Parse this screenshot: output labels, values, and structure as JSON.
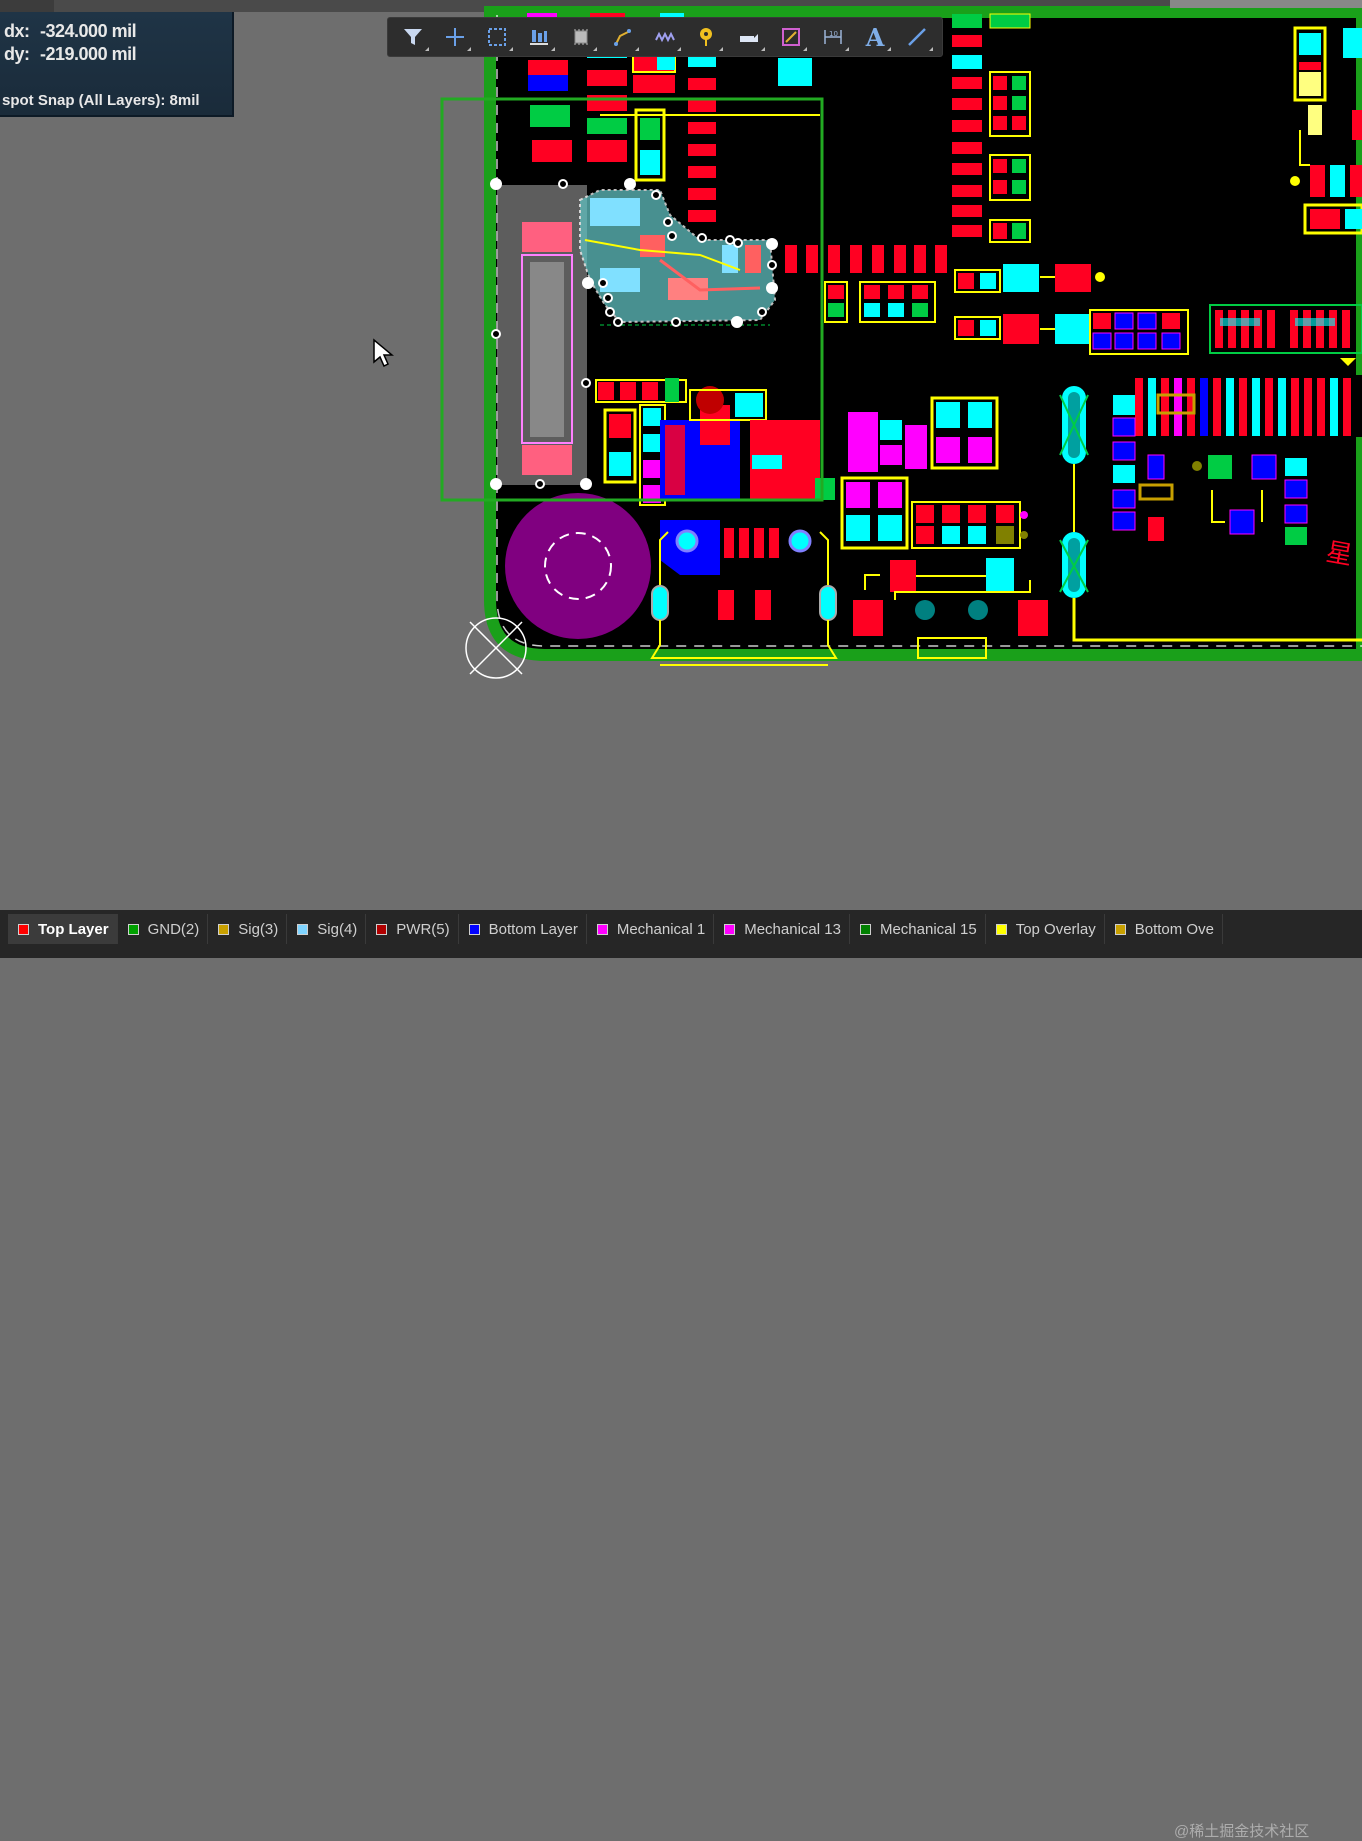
{
  "hud": {
    "dx_label": "dx:",
    "dx_value": "-324.000 mil",
    "dy_label": "dy:",
    "dy_value": "-219.000 mil",
    "snap_text": "spot Snap (All Layers): 8mil"
  },
  "toolbar": {
    "buttons": [
      {
        "icon": "filter-icon"
      },
      {
        "icon": "cross-add-icon"
      },
      {
        "icon": "select-rectangle-icon"
      },
      {
        "icon": "align-icon"
      },
      {
        "icon": "component-icon"
      },
      {
        "icon": "route-icon"
      },
      {
        "icon": "interactive-length-tune-icon"
      },
      {
        "icon": "place-via-icon"
      },
      {
        "icon": "polygon-pour-icon"
      },
      {
        "icon": "region-icon"
      },
      {
        "icon": "dimension-icon"
      },
      {
        "icon": "text-icon"
      },
      {
        "icon": "line-icon"
      }
    ],
    "text_icon_label": "A"
  },
  "layers": [
    {
      "name": "Top Layer",
      "color": "#ff0000",
      "active": true
    },
    {
      "name": "GND(2)",
      "color": "#00a000",
      "active": false
    },
    {
      "name": "Sig(3)",
      "color": "#c8a000",
      "active": false
    },
    {
      "name": "Sig(4)",
      "color": "#7fd4ff",
      "active": false
    },
    {
      "name": "PWR(5)",
      "color": "#b00000",
      "active": false
    },
    {
      "name": "Bottom Layer",
      "color": "#0000ff",
      "active": false
    },
    {
      "name": "Mechanical 1",
      "color": "#ff00ff",
      "active": false
    },
    {
      "name": "Mechanical 13",
      "color": "#ff00ff",
      "active": false
    },
    {
      "name": "Mechanical 15",
      "color": "#008000",
      "active": false
    },
    {
      "name": "Top Overlay",
      "color": "#ffff00",
      "active": false
    },
    {
      "name": "Bottom Ove",
      "color": "#c8a000",
      "active": false
    }
  ],
  "watermark": "@稀土掘金技术社区",
  "colors": {
    "board_bg": "#000000",
    "outline": "#1aa01a",
    "top": "#ff0022",
    "cyan": "#00ffff",
    "magenta": "#ff00ff",
    "overlay": "#ffff00",
    "bottom": "#0000ff",
    "selection": "#22aa22"
  }
}
